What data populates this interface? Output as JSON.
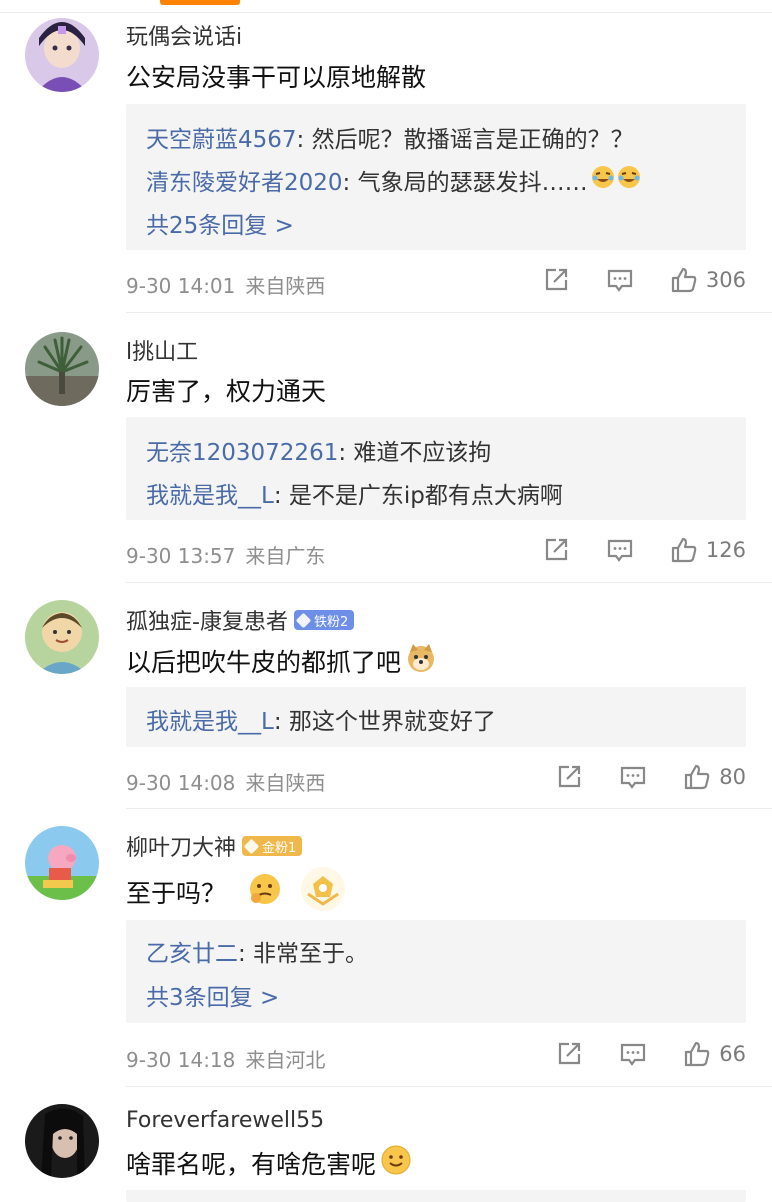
{
  "comments": [
    {
      "username": "玩偶会说话i",
      "badge": "",
      "text": "公安局没事干可以原地解散",
      "replies": [
        {
          "name": "天空蔚蓝4567",
          "content": ": 然后呢？散播谣言是正确的？？"
        },
        {
          "name": "清东陵爱好者2020",
          "content": ": 气象局的瑟瑟发抖……"
        }
      ],
      "more": "共25条回复 >",
      "time": "9-30 14:01",
      "location": "来自陕西",
      "likes": "306"
    },
    {
      "username": "l挑山工",
      "badge": "",
      "text": "厉害了，权力通天",
      "replies": [
        {
          "name": "无奈1203072261",
          "content": ": 难道不应该拘"
        },
        {
          "name": "我就是我__L",
          "content": ": 是不是广东ip都有点大病啊"
        }
      ],
      "more": "",
      "time": "9-30 13:57",
      "location": "来自广东",
      "likes": "126"
    },
    {
      "username": "孤独症-康复患者",
      "badge": "铁粉2",
      "text": "以后把吹牛皮的都抓了吧",
      "replies": [
        {
          "name": "我就是我__L",
          "content": ": 那这个世界就变好了"
        }
      ],
      "more": "",
      "time": "9-30 14:08",
      "location": "来自陕西",
      "likes": "80"
    },
    {
      "username": "柳叶刀大神",
      "badge": "金粉1",
      "text": "至于吗？",
      "replies": [
        {
          "name": "乙亥廿二",
          "content": ": 非常至于。"
        }
      ],
      "more": "共3条回复 >",
      "time": "9-30 14:18",
      "location": "来自河北",
      "likes": "66"
    },
    {
      "username": "Foreverfarewell55",
      "badge": "",
      "text": "啥罪名呢，有啥危害呢",
      "replies": [],
      "more": "",
      "time": "",
      "location": "",
      "likes": ""
    }
  ],
  "icons": {
    "share": "share-icon",
    "comment": "comment-icon",
    "like": "like-icon"
  },
  "colors": {
    "link": "#4a6ba8",
    "accent": "#ff8200",
    "reply_bg": "#f4f4f4"
  }
}
